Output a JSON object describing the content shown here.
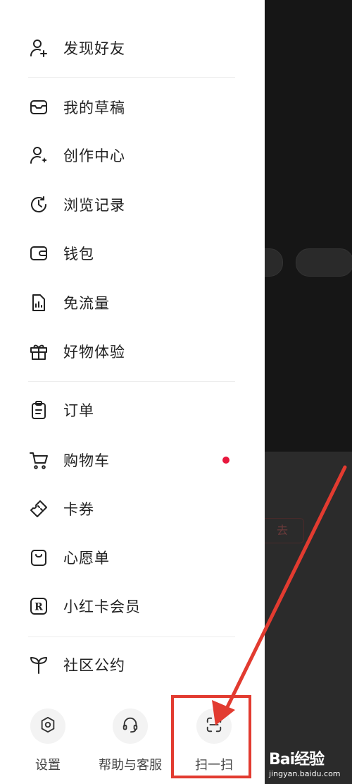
{
  "menu_groups": [
    {
      "items": [
        {
          "label": "发现好友",
          "icon": "add-user-icon"
        }
      ]
    },
    {
      "items": [
        {
          "label": "我的草稿",
          "icon": "drafts-icon"
        },
        {
          "label": "创作中心",
          "icon": "creator-center-icon"
        },
        {
          "label": "浏览记录",
          "icon": "history-clock-icon"
        },
        {
          "label": "钱包",
          "icon": "wallet-icon"
        },
        {
          "label": "免流量",
          "icon": "data-free-icon"
        },
        {
          "label": "好物体验",
          "icon": "gift-icon"
        }
      ]
    },
    {
      "items": [
        {
          "label": "订单",
          "icon": "order-icon"
        },
        {
          "label": "购物车",
          "icon": "cart-icon",
          "badge_color": "#e8173d"
        },
        {
          "label": "卡券",
          "icon": "coupon-icon"
        },
        {
          "label": "心愿单",
          "icon": "wishlist-icon"
        },
        {
          "label": "小红卡会员",
          "icon": "membership-r-icon"
        }
      ]
    },
    {
      "items": [
        {
          "label": "社区公约",
          "icon": "sprout-icon"
        }
      ]
    }
  ],
  "bottom_actions": [
    {
      "label": "设置",
      "icon": "gear-icon"
    },
    {
      "label": "帮助与客服",
      "icon": "headset-icon"
    },
    {
      "label": "扫一扫",
      "icon": "scan-icon"
    }
  ],
  "background_app": {
    "partial_text": "去"
  },
  "annotation": {
    "color": "#e23b30"
  },
  "watermark": {
    "logo": "Bai经验",
    "url": "jingyan.baidu.com"
  }
}
